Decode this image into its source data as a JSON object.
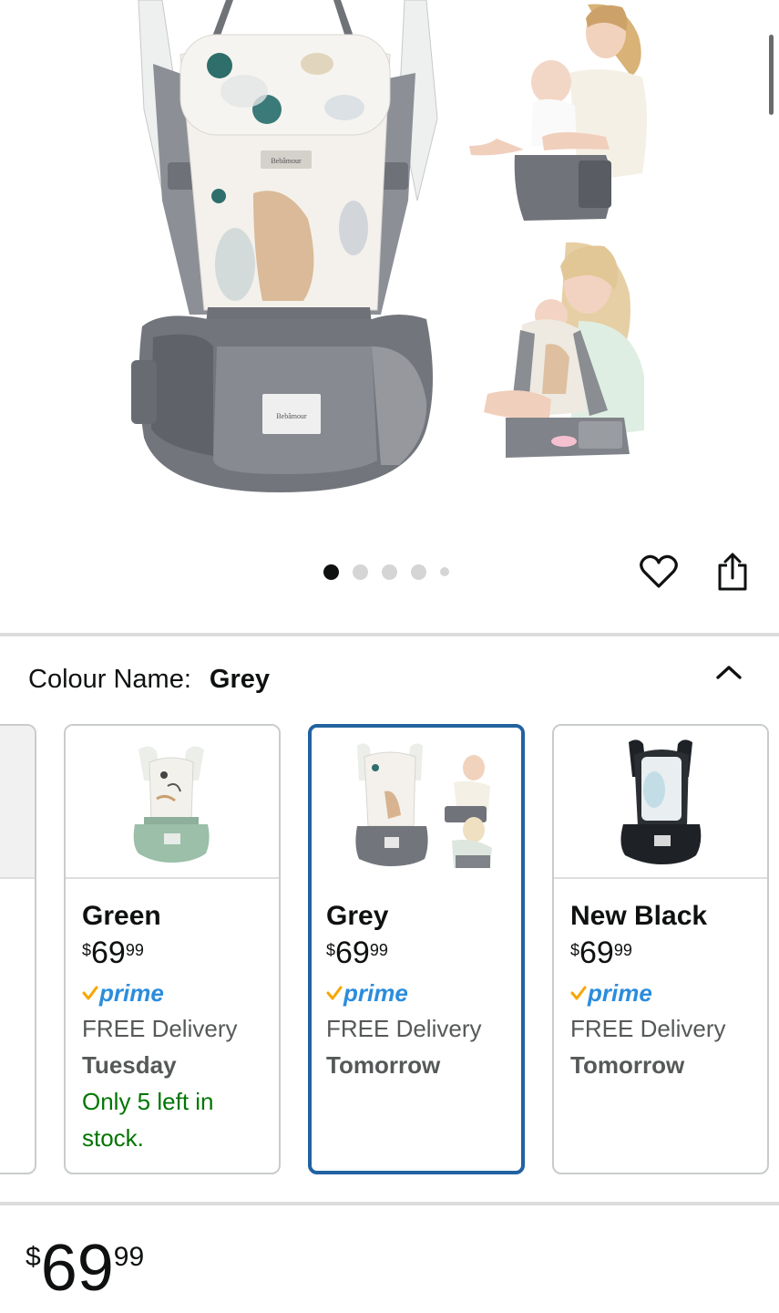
{
  "gallery": {
    "main_image": "grey-hip-seat-carrier",
    "thumbnails": [
      "woman-holding-baby-on-hip-seat",
      "woman-carrying-baby-in-carrier"
    ],
    "brand_tag": "Bebamour",
    "dots": {
      "count": 5,
      "active_index": 0
    }
  },
  "actions": {
    "favourite_icon": "heart-icon",
    "share_icon": "share-icon"
  },
  "colour": {
    "label": "Colour Name:",
    "value": "Grey",
    "collapse_icon": "chevron-up-icon"
  },
  "swatches": [
    {
      "name": "Green",
      "price": {
        "currency": "$",
        "whole": "69",
        "fraction": "99"
      },
      "prime": "prime",
      "delivery": "FREE Delivery",
      "delivery_day": "Tuesday",
      "stock_line1": "Only 5 left in",
      "stock_line2": "stock.",
      "color": "#9bbfa9"
    },
    {
      "name": "Grey",
      "price": {
        "currency": "$",
        "whole": "69",
        "fraction": "99"
      },
      "prime": "prime",
      "delivery": "FREE Delivery",
      "delivery_day": "Tomorrow",
      "color": "#6e7179",
      "selected": true
    },
    {
      "name": "New Black",
      "price": {
        "currency": "$",
        "whole": "69",
        "fraction": "99"
      },
      "prime": "prime",
      "delivery": "FREE Delivery",
      "delivery_day": "Tomorrow",
      "color": "#1e2126"
    }
  ],
  "price": {
    "currency": "$",
    "whole": "69",
    "fraction": "99"
  },
  "colors": {
    "selected_border": "#2162a1",
    "prime_blue": "#2b8ddd",
    "prime_check": "#f7a600",
    "in_stock_green": "#007600"
  }
}
